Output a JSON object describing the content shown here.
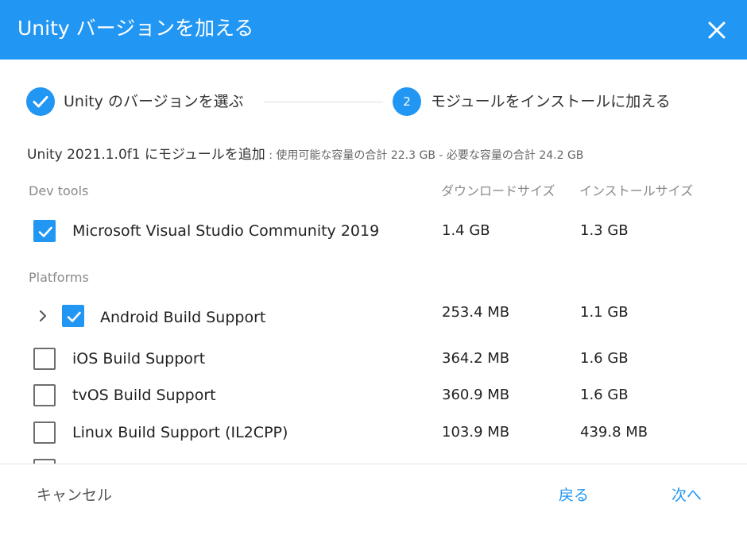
{
  "dialog": {
    "title": "Unity バージョンを加える"
  },
  "steps": [
    {
      "label": "Unity のバージョンを選ぶ",
      "state": "done"
    },
    {
      "number": "2",
      "label": "モジュールをインストールに加える",
      "state": "active"
    }
  ],
  "summary": {
    "main": "Unity 2021.1.0f1 にモジュールを追加",
    "detail": " : 使用可能な容量の合計 22.3 GB - 必要な容量の合計 24.2 GB"
  },
  "columns": {
    "download": "ダウンロードサイズ",
    "install": "インストールサイズ"
  },
  "sections": {
    "dev_tools": "Dev tools",
    "platforms": "Platforms"
  },
  "modules": [
    {
      "name": "Microsoft Visual Studio Community 2019",
      "download": "1.4 GB",
      "install": "1.3 GB",
      "checked": true
    },
    {
      "name": "Android Build Support",
      "download": "253.4 MB",
      "install": "1.1 GB",
      "checked": true,
      "expandable": true
    },
    {
      "name": "iOS Build Support",
      "download": "364.2 MB",
      "install": "1.6 GB",
      "checked": false
    },
    {
      "name": "tvOS Build Support",
      "download": "360.9 MB",
      "install": "1.6 GB",
      "checked": false
    },
    {
      "name": "Linux Build Support (IL2CPP)",
      "download": "103.9 MB",
      "install": "439.8 MB",
      "checked": false
    }
  ],
  "footer": {
    "cancel": "キャンセル",
    "back": "戻る",
    "next": "次へ"
  },
  "colors": {
    "accent": "#2196f3",
    "header_text": "#ffffff"
  },
  "icons": {
    "close": "close-icon",
    "check": "checkmark-icon",
    "expand": "chevron-right-icon"
  }
}
